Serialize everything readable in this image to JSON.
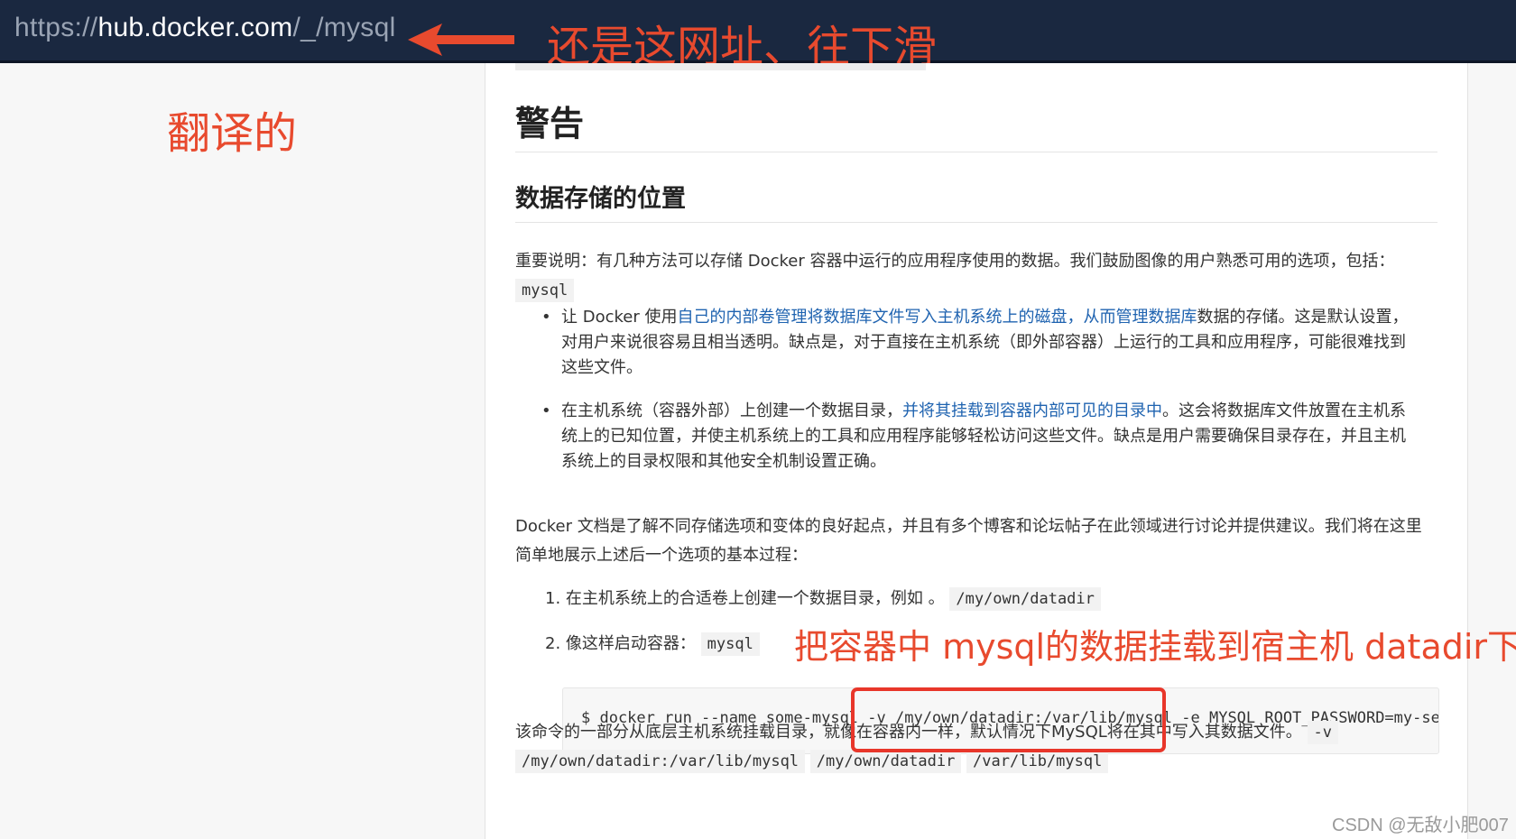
{
  "browser": {
    "url_prefix": "https://",
    "url_host": "hub.docker.com",
    "url_path": "/_/mysql"
  },
  "annotations": {
    "top_note": "还是这网址、往下滑",
    "left_note": "翻译的",
    "middle_note": "把容器中 mysql的数据挂载到宿主机 datadir下",
    "highlight_color": "#e8362a"
  },
  "article": {
    "heading": "警告",
    "subheading": "数据存储的位置",
    "intro_text": "重要说明：有几种方法可以存储 Docker 容器中运行的应用程序使用的数据。我们鼓励图像的用户熟悉可用的选项，包括：",
    "intro_code": "mysql",
    "bullet1_pre": "让 Docker 使用",
    "bullet1_link": "自己的内部卷管理将数据库文件写入主机系统上的磁盘，从而管理数据库",
    "bullet1_post": "数据的存储。这是默认设置，对用户来说很容易且相当透明。缺点是，对于直接在主机系统（即外部容器）上运行的工具和应用程序，可能很难找到这些文件。",
    "bullet2_pre": "在主机系统（容器外部）上创建一个数据目录，",
    "bullet2_link": "并将其挂载到容器内部可见的目录中",
    "bullet2_post": "。这会将数据库文件放置在主机系统上的已知位置，并使主机系统上的工具和应用程序能够轻松访问这些文件。缺点是用户需要确保目录存在，并且主机系统上的目录权限和其他安全机制设置正确。",
    "docs_text": "Docker 文档是了解不同存储选项和变体的良好起点，并且有多个博客和论坛帖子在此领域进行讨论并提供建议。我们将在这里简单地展示上述后一个选项的基本过程：",
    "step1_text": "1. 在主机系统上的合适卷上创建一个数据目录，例如 。",
    "step1_code": "/my/own/datadir",
    "step2_text": "2. 像这样启动容器：",
    "step2_code": "mysql",
    "command": "$ docker run --name some-mysql -v /my/own/datadir:/var/lib/mysql -e MYSQL_ROOT_PASSWORD=my-secr",
    "after_text": "该命令的一部分从底层主机系统挂载目录，就像在容器内一样，默认情况下MySQL将在其中写入其数据文件。",
    "after_code1": "-v",
    "after_code2": "/my/own/datadir:/var/lib/mysql",
    "after_code3": "/my/own/datadir",
    "after_code4": "/var/lib/mysql"
  },
  "watermark": "CSDN @无敌小肥007"
}
